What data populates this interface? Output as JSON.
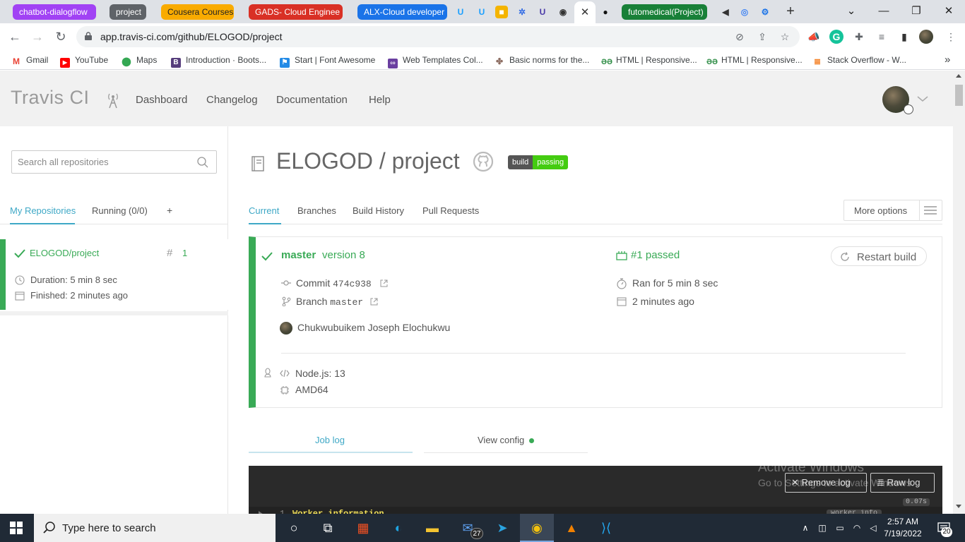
{
  "browser": {
    "tabs": [
      {
        "label": "chatbot-dialogflow",
        "color": "#a142f4"
      },
      {
        "label": "project",
        "color": "#5f6368"
      },
      {
        "label": "Cousera Courses",
        "color": "#f9ab00"
      },
      {
        "label": "GADS- Cloud Enginee",
        "color": "#d93025"
      },
      {
        "label": "ALX-Cloud developer",
        "color": "#1a73e8"
      },
      {
        "label": "futomedical(Project)",
        "color": "#188038"
      }
    ],
    "url": "app.travis-ci.com/github/ELOGOD/project",
    "bookmarks": [
      {
        "label": "Gmail",
        "icon": "gmail-icon"
      },
      {
        "label": "YouTube",
        "icon": "youtube-icon"
      },
      {
        "label": "Maps",
        "icon": "maps-icon"
      },
      {
        "label": "Introduction · Boots...",
        "icon": "bootstrap-icon"
      },
      {
        "label": "Start | Font Awesome",
        "icon": "font-awesome-icon"
      },
      {
        "label": "Web Templates Col...",
        "icon": "colorlib-icon"
      },
      {
        "label": "Basic norms for the...",
        "icon": "tree-icon"
      },
      {
        "label": "HTML | Responsive...",
        "icon": "geeks-icon"
      },
      {
        "label": "HTML | Responsive...",
        "icon": "geeks-icon"
      },
      {
        "label": "Stack Overflow - W...",
        "icon": "stackoverflow-icon"
      }
    ],
    "bookmarks_more": "»"
  },
  "travis": {
    "logo": "Travis CI",
    "nav": [
      "Dashboard",
      "Changelog",
      "Documentation",
      "Help"
    ]
  },
  "sidebar": {
    "search_placeholder": "Search all repositories",
    "tabs": {
      "my_repos": "My Repositories",
      "running": "Running (0/0)",
      "add": "+"
    },
    "repo": {
      "name": "ELOGOD/project",
      "hash": "#",
      "build_number": "1",
      "duration": "Duration: 5 min 8 sec",
      "finished": "Finished: 2 minutes ago"
    }
  },
  "main": {
    "title": "ELOGOD / project",
    "badge": {
      "left": "build",
      "right": "passing"
    },
    "tabs": [
      "Current",
      "Branches",
      "Build History",
      "Pull Requests"
    ],
    "more_options": "More options",
    "build": {
      "branch": "master",
      "message": "version 8",
      "status": "#1 passed",
      "restart": "Restart build",
      "commit_label": "Commit",
      "commit_hash": "474c938",
      "branch_label": "Branch",
      "branch_value": "master",
      "ran_for": "Ran for 5 min 8 sec",
      "ago": "2 minutes ago",
      "author": "Chukwubuikem Joseph Elochukwu",
      "language": "Node.js: 13",
      "arch": "AMD64"
    },
    "log_tabs": {
      "job_log": "Job log",
      "view_config": "View config"
    },
    "log": {
      "remove_log": "Remove log",
      "raw_log": "Raw log",
      "line_number": "1",
      "first_line": "Worker information",
      "timer": "0.07s",
      "worker_info": "worker_info"
    },
    "watermark": {
      "line1": "Activate Windows",
      "line2": "Go to Settings to activate Windows."
    }
  },
  "taskbar": {
    "search_text": "Type here to search",
    "mail_badge": "27",
    "time": "2:57 AM",
    "date": "7/19/2022",
    "notification_count": "20"
  },
  "colors": {
    "travis_green": "#39aa56",
    "travis_blue": "#3ea8c6",
    "badge_green": "#44cc11"
  }
}
